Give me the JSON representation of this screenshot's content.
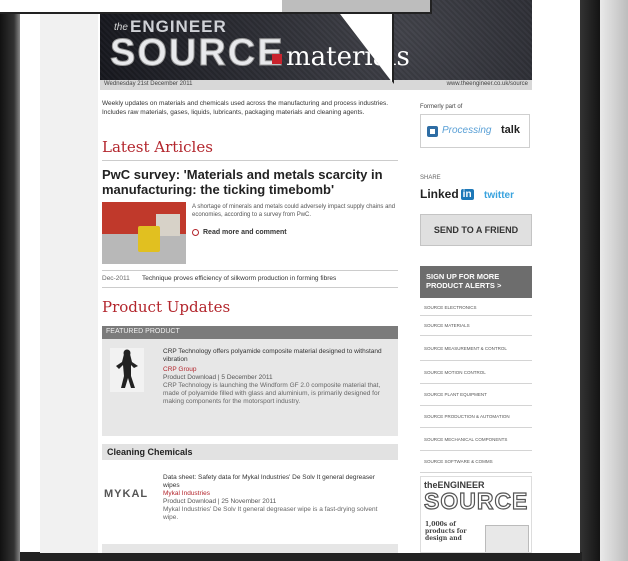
{
  "header": {
    "logo_the": "the",
    "logo_engineer": "ENGINEER",
    "logo_source": "SOURCE",
    "logo_materials": "materials",
    "date": "Wednesday 21st December 2011",
    "url": "www.theengineer.co.uk/source"
  },
  "intro": "Weekly updates on materials and chemicals used across the manufacturing and process industries. Includes raw materials, gases, liquids, lubricants, packaging materials and cleaning agents.",
  "latest": {
    "heading": "Latest Articles",
    "article_title": "PwC survey: 'Materials and metals scarcity in manufacturing: the ticking timebomb'",
    "article_text": "A shortage of minerals and metals could adversely impact supply chains and economies, according to a survey from PwC.",
    "read_more": "Read more and comment",
    "row_date": "Dec-2011",
    "row_title": "Technique proves efficiency of silkworm production in forming fibres"
  },
  "products": {
    "heading": "Product Updates",
    "featured_label": "FEATURED PRODUCT",
    "featured_title": "CRP Technology offers polyamide composite material designed to withstand vibration",
    "featured_company": "CRP Group",
    "featured_meta": "Product Download | 5 December 2011",
    "featured_desc": "CRP Technology is launching the Windform GF 2.0 composite material that, made of polyamide filled with glass and aluminium, is primarily designed for making components for the motorsport industry.",
    "category": "Cleaning Chemicals",
    "clean_logo": "MYKAL",
    "clean_title": "Data sheet: Safety data for Mykal Industries' De Solv It general degreaser wipes",
    "clean_company": "Mykal Industries",
    "clean_meta": "Product Download | 25 November 2011",
    "clean_desc": "Mykal Industries' De Solv It general degreaser wipe is a fast-drying solvent wipe."
  },
  "sidebar": {
    "formerly": "Formerly part of",
    "ptalk_processing": "Processing",
    "ptalk_talk": "talk",
    "share": "SHARE",
    "linkedin_text": "Linked",
    "linkedin_in": "in",
    "twitter": "twitter",
    "send_friend": "SEND TO A FRIEND",
    "signup": "SIGN UP FOR MORE PRODUCT ALERTS >",
    "categories": [
      "SOURCE ELECTRONICS",
      "SOURCE MATERIALS",
      "SOURCE MEASUREMENT & CONTROL",
      "SOURCE MOTION CONTROL",
      "SOURCE PLANT EQUIPMENT",
      "SOURCE PRODUCTION & AUTOMATION",
      "SOURCE MECHANICAL COMPONENTS",
      "SOURCE SOFTWARE & COMMS"
    ],
    "ad_the": "theENGINEER",
    "ad_source": "SOURCE",
    "ad_copy": "1,000s of products for design and"
  },
  "colors": {
    "accent_red": "#b3262d",
    "banner_gray": "#5b5d68",
    "sidebar_dark": "#6d6d6d"
  }
}
